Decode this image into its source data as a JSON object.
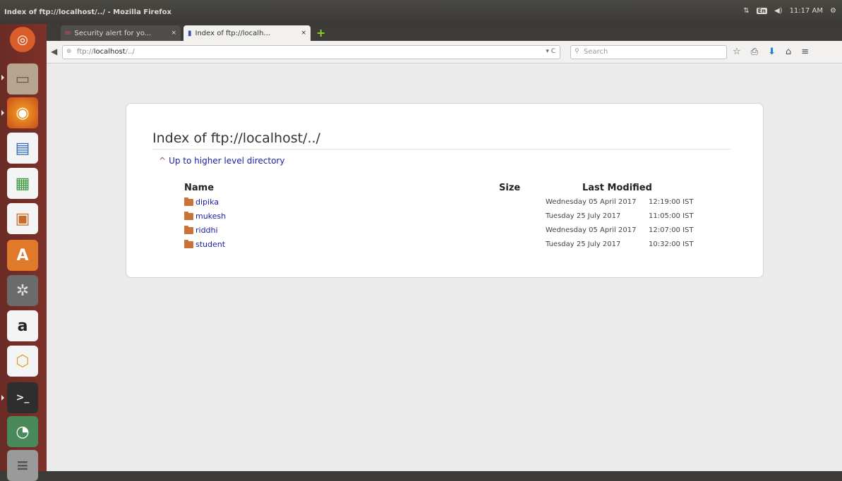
{
  "window": {
    "title": "Index of ftp://localhost/../ - Mozilla Firefox"
  },
  "panel": {
    "kbd_layout": "En",
    "volume_icon": "speaker-icon",
    "clock": "11:17 AM"
  },
  "tabs": [
    {
      "label": "Security alert for yo...",
      "close": "×",
      "icon": "mail-icon"
    },
    {
      "label": "Index of ftp://localh...",
      "close": "×",
      "icon": "folder-icon"
    }
  ],
  "new_tab": "+",
  "nav": {
    "url_prefix": "ftp://",
    "url_host": "localhost",
    "url_path": "/../",
    "reload": "▾ C",
    "search_placeholder": "Search"
  },
  "page": {
    "title": "Index of ftp://localhost/../",
    "up_link": "Up to higher level directory",
    "columns": {
      "name": "Name",
      "size": "Size",
      "modified": "Last Modified"
    },
    "rows": [
      {
        "name": "dipika",
        "date": "Wednesday 05 April 2017",
        "time": "12:19:00 IST"
      },
      {
        "name": "mukesh",
        "date": "Tuesday 25 July 2017",
        "time": "11:05:00 IST"
      },
      {
        "name": "riddhi",
        "date": "Wednesday 05 April 2017",
        "time": "12:07:00 IST"
      },
      {
        "name": "student",
        "date": "Tuesday 25 July 2017",
        "time": "10:32:00 IST"
      }
    ]
  },
  "launcher": {
    "amazon_glyph": "a",
    "icons": [
      "ubuntu-icon",
      "files-icon",
      "firefox-icon",
      "writer-icon",
      "calc-icon",
      "impress-icon",
      "software-center-icon",
      "settings-icon",
      "amazon-icon",
      "unity-icon",
      "terminal-icon",
      "updater-icon",
      "trash-icon"
    ]
  },
  "colors": {
    "launcher": "#7d3128",
    "link": "#1c1ca5",
    "folder": "#c9733b"
  }
}
